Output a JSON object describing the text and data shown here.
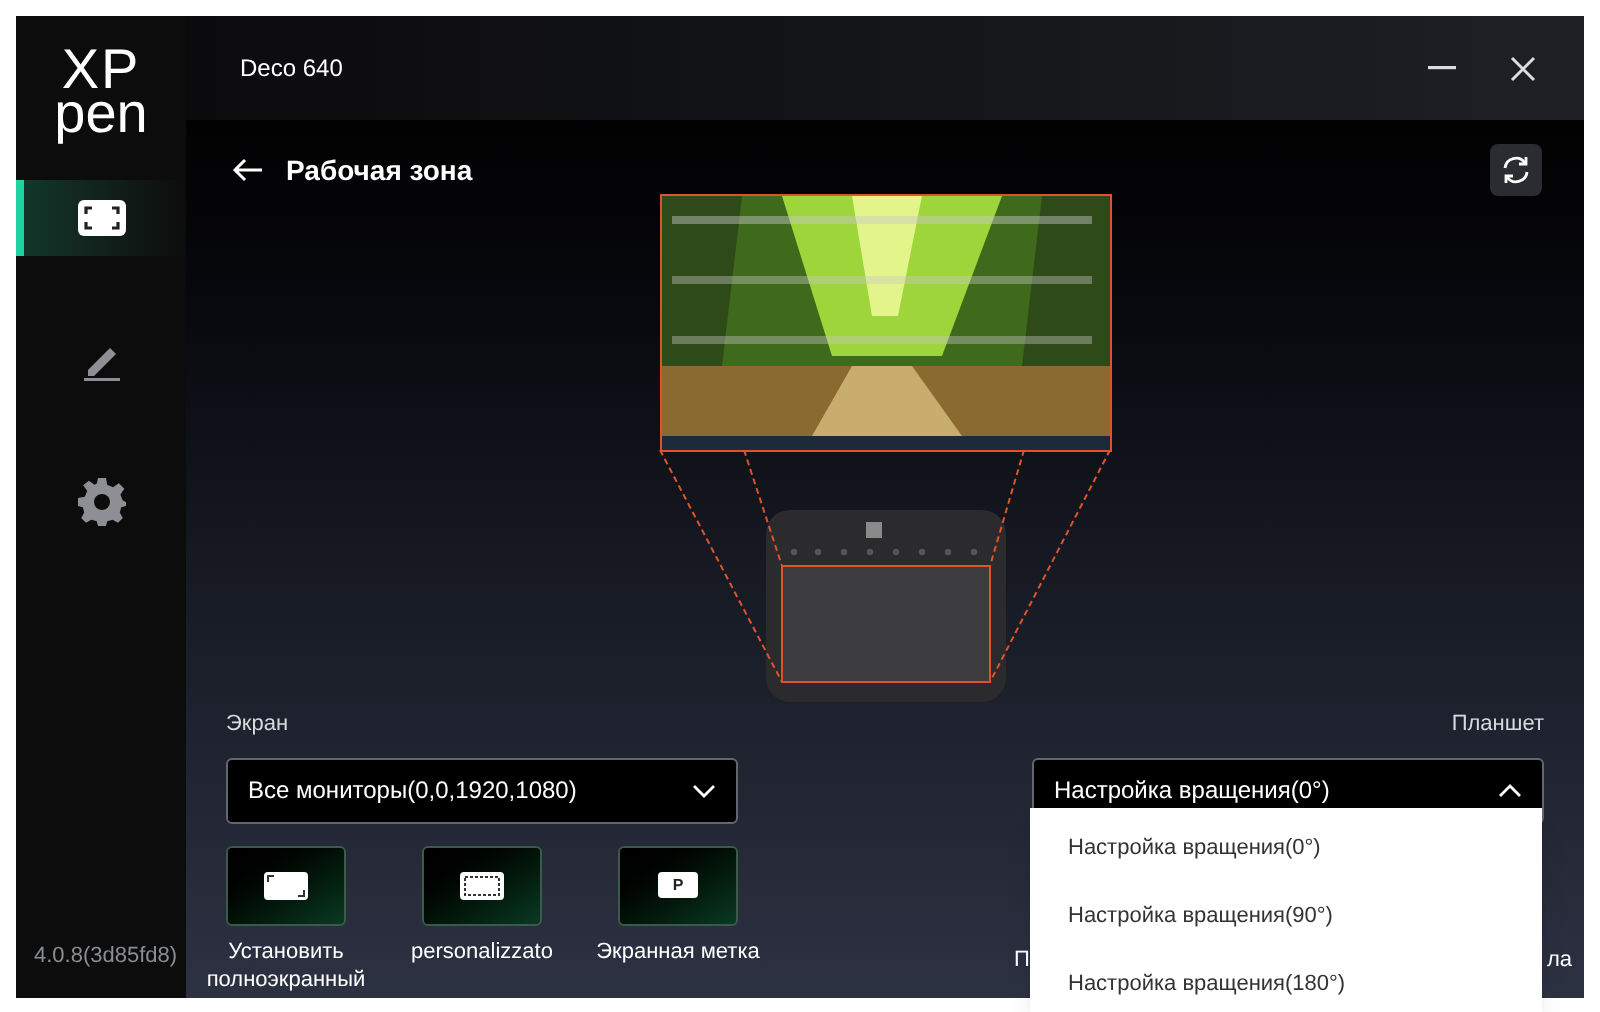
{
  "window": {
    "title": "Deco 640"
  },
  "logo": {
    "top": "XP",
    "bottom": "pen"
  },
  "sidebar": {
    "items": [
      {
        "kind": "workspace",
        "selected": true
      },
      {
        "kind": "pen",
        "selected": false
      },
      {
        "kind": "settings",
        "selected": false
      }
    ]
  },
  "version": "4.0.8(3d85fd8)",
  "page": {
    "title": "Рабочая зона"
  },
  "screen": {
    "label": "Экран",
    "dropdown": {
      "value": "Все мониторы(0,0,1920,1080)",
      "expanded": false
    },
    "buttons": [
      {
        "kind": "fullscreen",
        "label": "Установить полноэкранный"
      },
      {
        "kind": "custom",
        "label": "personalizzato"
      },
      {
        "kind": "mark",
        "label": "Экранная метка",
        "icon_label": "P"
      }
    ]
  },
  "tablet": {
    "label": "Планшет",
    "dropdown": {
      "value": "Настройка вращения(0°)",
      "expanded": true,
      "options": [
        "Настройка вращения(0°)",
        "Настройка вращения(90°)",
        "Настройка вращения(180°)"
      ]
    },
    "partial_labels": [
      "П",
      "ла"
    ]
  }
}
